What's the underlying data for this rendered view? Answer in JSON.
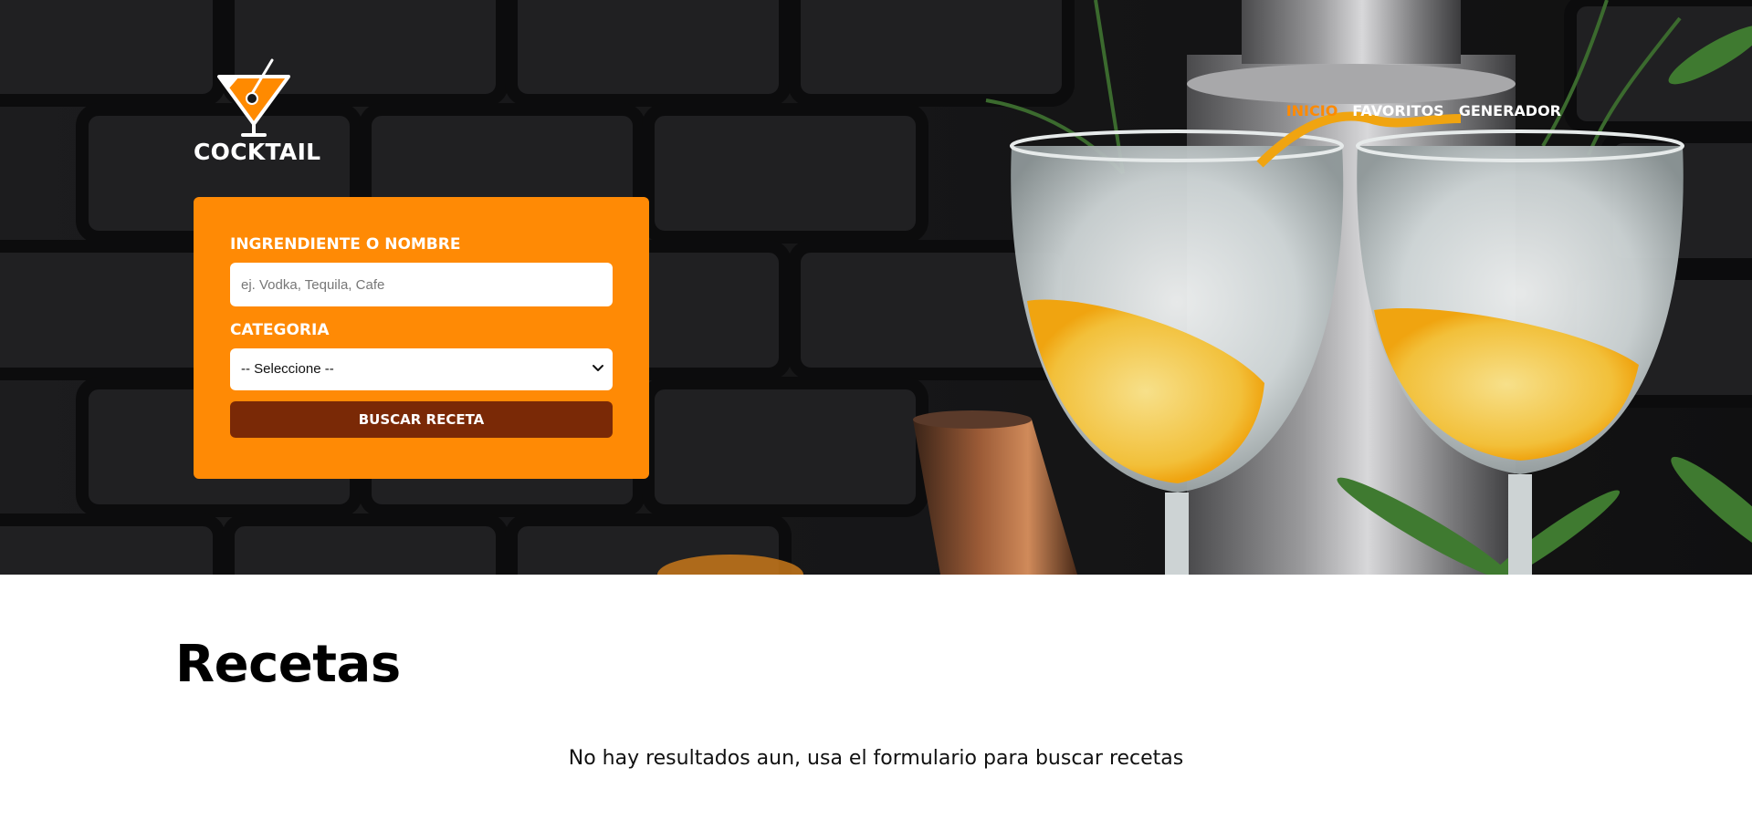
{
  "brand": {
    "name": "COCKTAIL",
    "accent_color": "#ff8a00",
    "logo_icon": "martini-glass-icon"
  },
  "nav": {
    "items": [
      {
        "label": "Inicio",
        "active": true
      },
      {
        "label": "Favoritos",
        "active": false
      },
      {
        "label": "Generador",
        "active": false
      }
    ]
  },
  "search": {
    "name_label": "Ingrendiente o Nombre",
    "name_placeholder": "ej. Vodka, Tequila, Cafe",
    "name_value": "",
    "category_label": "Categoria",
    "category_selected": "-- Seleccione --",
    "submit_label": "Buscar Receta",
    "card_color": "#ff8a05",
    "button_color": "#7a2906"
  },
  "results": {
    "title": "Recetas",
    "empty_message": "No hay resultados aun, usa el formulario para buscar recetas"
  }
}
